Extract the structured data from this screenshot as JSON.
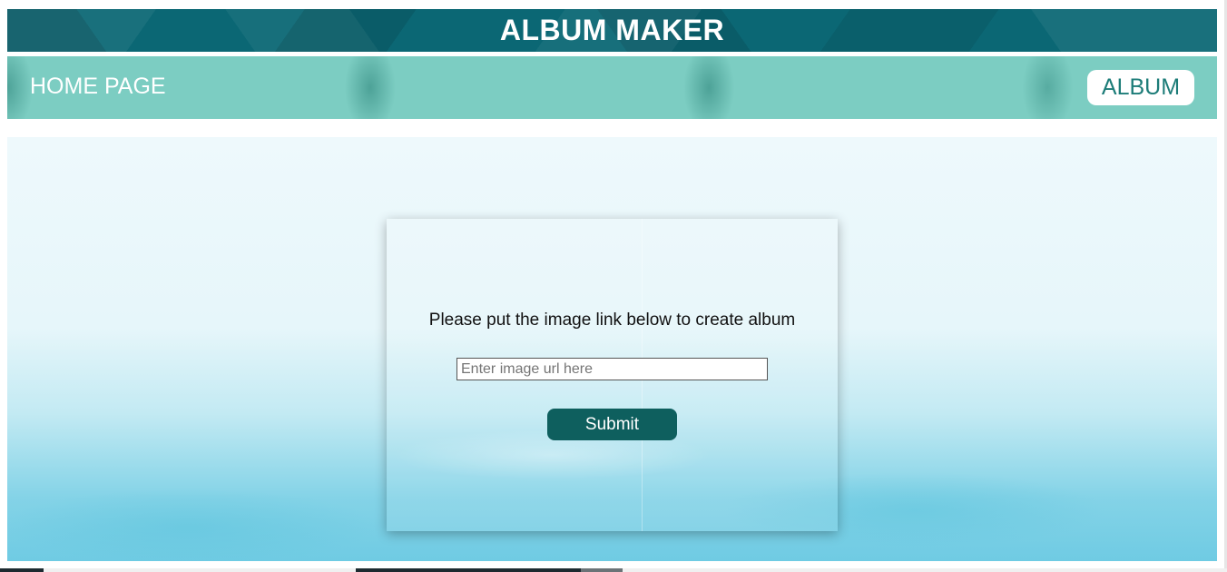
{
  "header": {
    "title": "ALBUM MAKER"
  },
  "nav": {
    "home_label": "HOME PAGE",
    "album_label": "ALBUM"
  },
  "form": {
    "prompt": "Please put the image link below to create album",
    "url_placeholder": "Enter image url here",
    "url_value": "",
    "submit_label": "Submit"
  },
  "colors": {
    "header_bg": "#0b6774",
    "nav_bg": "#7ccdc2",
    "submit_bg": "#0e5f5e",
    "album_text": "#1c7c78"
  }
}
